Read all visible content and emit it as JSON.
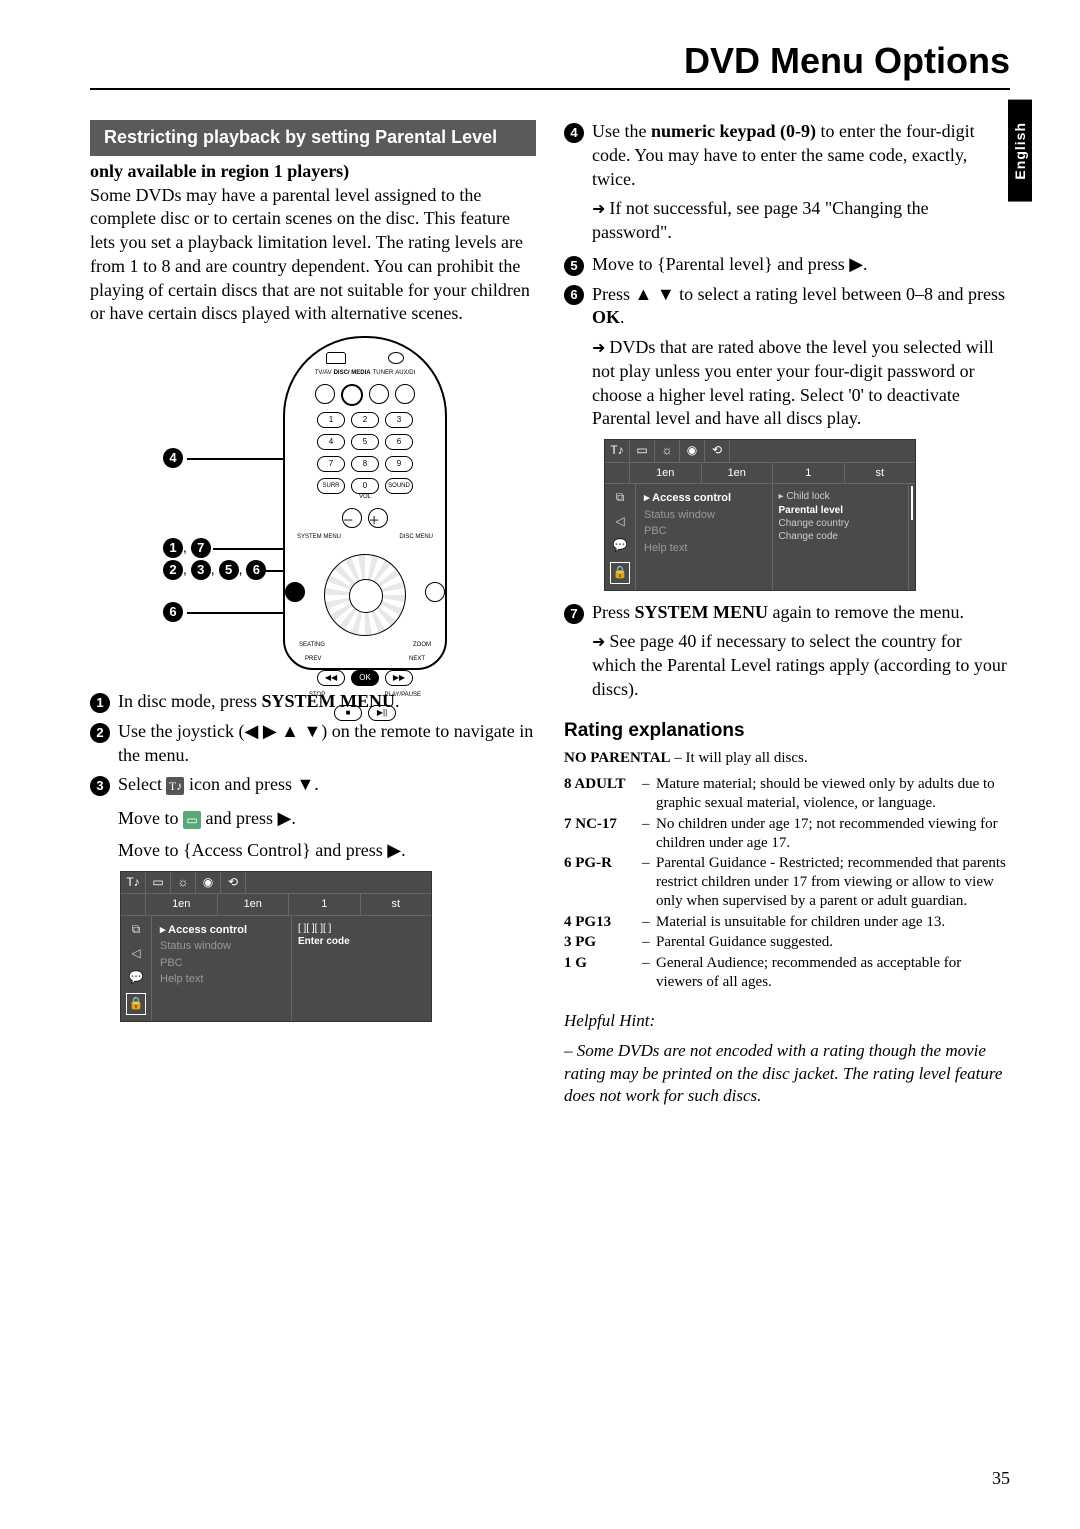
{
  "title": "DVD Menu Options",
  "language_tab": "English",
  "page_number": "35",
  "left": {
    "section_header": "Restricting playback by setting Parental Level",
    "subnote": "only available in region 1 players)",
    "intro": "Some DVDs may have a parental level assigned to the complete disc or to certain scenes on the disc. This feature lets you set a playback limitation level. The rating levels are from 1 to 8 and are country dependent. You can prohibit the playing of certain discs that are not suitable for your children or have certain discs played with alternative scenes.",
    "remote_labels": {
      "group4": "4",
      "group17": "1, 7",
      "group2356": "2, 3, 5, 6",
      "group6": "6",
      "tv_av": "TV/AV",
      "disc_media": "DISC/\nMEDIA",
      "tuner": "TUNER",
      "aux_di": "AUX/DI",
      "surr": "SURR",
      "sound": "SOUND",
      "vol": "VOL",
      "system_menu": "SYSTEM MENU",
      "disc_menu": "DISC MENU",
      "seating": "SEATING",
      "zoom": "ZOOM",
      "prev": "PREV",
      "next": "NEXT",
      "ok": "OK",
      "stop": "STOP",
      "play_pause": "PLAY/PAUSE"
    },
    "steps": {
      "s1": "In disc mode, press ",
      "s1b": "SYSTEM MENU",
      "s2": "Use the joystick (◀ ▶ ▲ ▼) on the remote to navigate in the menu.",
      "s3a": "Select ",
      "s3b": " icon and press ▼.",
      "s3_move1a": "Move to ",
      "s3_move1b": " and press ▶.",
      "s3_move2": "Move to {Access Control} and press ▶."
    },
    "osd1": {
      "tabs": [
        "1en",
        "1en",
        "1",
        "st"
      ],
      "icons": [
        "T♪",
        "▭",
        "☼",
        "◉",
        "⟲"
      ],
      "side": [
        "⧉",
        "◁",
        "💬",
        "🔒"
      ],
      "items": [
        "Access control",
        "Status window",
        "PBC",
        "Help text"
      ],
      "right": [
        "[  ][  ][  ][  ]",
        "Enter code"
      ]
    }
  },
  "right": {
    "steps": {
      "s4a": "Use the ",
      "s4b": "numeric keypad (0-9)",
      "s4c": " to enter the four-digit code.  You may have to enter the same code, exactly, twice.",
      "s4_sub": "If not successful, see page 34 \"Changing the password\".",
      "s5": "Move to {Parental level} and press ▶.",
      "s6a": "Press ▲ ▼ to select a rating level between 0–8 and press ",
      "s6b": "OK",
      "s6_sub": "DVDs that are rated above the level you selected will not play unless you enter your four-digit password or choose a higher level rating.  Select '0' to deactivate Parental level and have all discs play.",
      "s7a": "Press ",
      "s7b": "SYSTEM MENU",
      "s7c": " again to remove the menu.",
      "s7_sub": "See page 40 if necessary to select the country for which the Parental Level ratings apply (according to your discs)."
    },
    "osd2": {
      "tabs": [
        "1en",
        "1en",
        "1",
        "st"
      ],
      "icons": [
        "T♪",
        "▭",
        "☼",
        "◉",
        "⟲"
      ],
      "side": [
        "⧉",
        "◁",
        "💬",
        "🔒"
      ],
      "left_items": [
        "Access control",
        "Status window",
        "PBC",
        "Help text"
      ],
      "right_items": [
        "Child lock",
        "Parental level",
        "Change country",
        "Change code"
      ]
    },
    "ratings_header": "Rating explanations",
    "ratings": [
      {
        "label": "NO PARENTAL",
        "desc": "– It will play all discs."
      },
      {
        "label": "8 ADULT",
        "desc": "Mature material; should be viewed only by adults due to graphic sexual material, violence, or language."
      },
      {
        "label": "7 NC-17",
        "desc": "No children under age 17; not recommended viewing for children under age 17."
      },
      {
        "label": "6 PG-R",
        "desc": "Parental Guidance - Restricted; recommended that parents restrict children under 17 from viewing or allow to view only when supervised by a parent or adult guardian."
      },
      {
        "label": "4 PG13",
        "desc": "Material is unsuitable for children under age 13."
      },
      {
        "label": "3 PG",
        "desc": "Parental Guidance suggested."
      },
      {
        "label": "1 G",
        "desc": "General Audience; recommended as acceptable for viewers of all ages."
      }
    ],
    "hint_title": "Helpful Hint:",
    "hint_body": "– Some DVDs are not encoded with a rating though the movie rating may be printed on the disc jacket. The rating level feature does not work for such discs."
  }
}
